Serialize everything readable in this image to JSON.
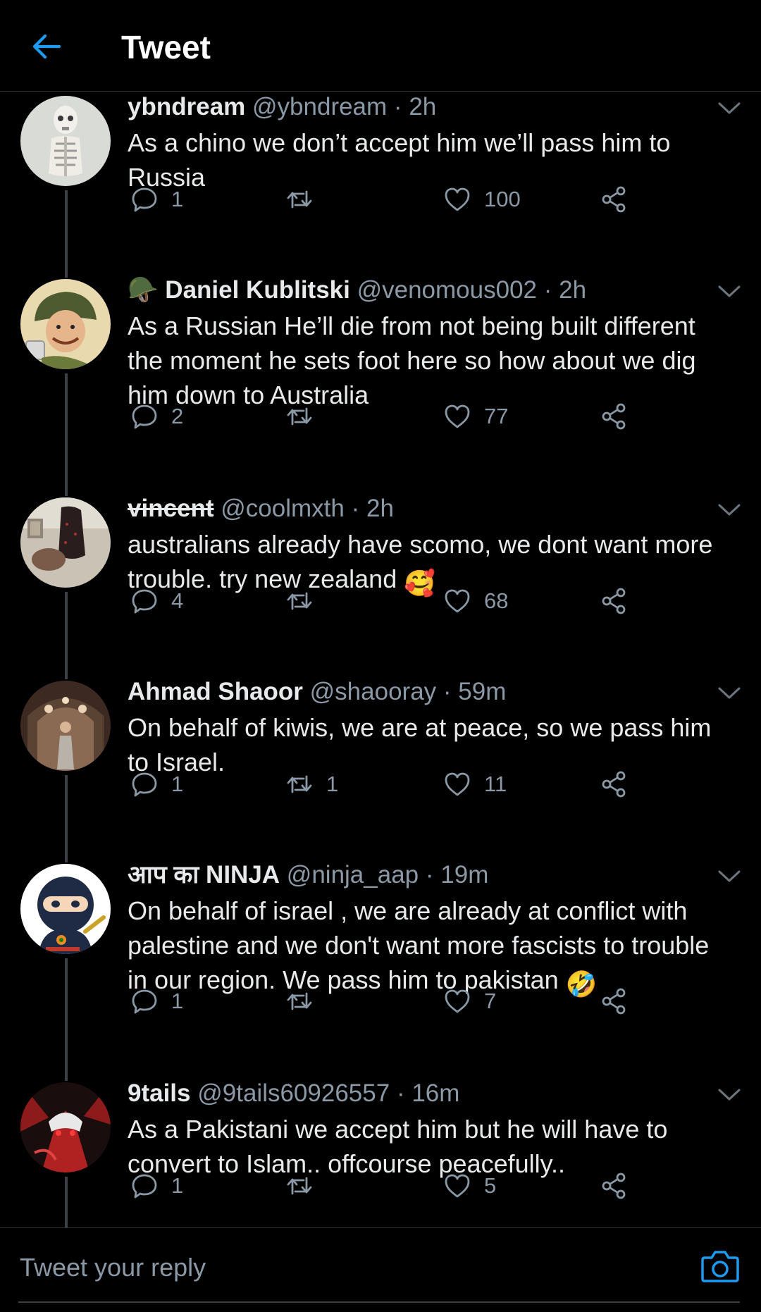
{
  "header": {
    "title": "Tweet"
  },
  "tweets": [
    {
      "name": "ybndream",
      "handle": "@ybndream",
      "time": "2h",
      "text": "As a chino we don’t accept him we’ll pass him to Russia",
      "emoji": "",
      "replies": "1",
      "retweets": "",
      "likes": "100",
      "strike": false
    },
    {
      "name": "🪖 Daniel Kublitski",
      "handle": "@venomous002",
      "time": "2h",
      "text": "As a Russian He’ll die from not being built different the moment he sets foot here so how about we dig him down to Australia",
      "emoji": "",
      "replies": "2",
      "retweets": "",
      "likes": "77",
      "strike": false
    },
    {
      "name": "vincent",
      "handle": "@coolmxth",
      "time": "2h",
      "text": "australians already have scomo, we dont want more trouble. try new zealand",
      "emoji": "🥰",
      "replies": "4",
      "retweets": "",
      "likes": "68",
      "strike": true
    },
    {
      "name": "Ahmad Shaoor",
      "handle": "@shaooray",
      "time": "59m",
      "text": "On behalf of kiwis, we are at peace, so we pass him to Israel.",
      "emoji": "",
      "replies": "1",
      "retweets": "1",
      "likes": "11",
      "strike": false
    },
    {
      "name": "आप का NINJA",
      "handle": "@ninja_aap",
      "time": "19m",
      "text": "On behalf of israel , we are already at conflict with palestine and we don't want more fascists to trouble in our region. We pass him to pakistan",
      "emoji": "🤣",
      "replies": "1",
      "retweets": "",
      "likes": "7",
      "strike": false
    },
    {
      "name": "9tails",
      "handle": "@9tails60926557",
      "time": "16m",
      "text": "As a Pakistani we accept him but he will have to convert to Islam.. offcourse peacefully..",
      "emoji": "",
      "replies": "1",
      "retweets": "",
      "likes": "5",
      "strike": false
    }
  ],
  "sep": "·",
  "reply_bar": {
    "placeholder": "Tweet your reply"
  },
  "colors": {
    "accent": "#1d9bf0",
    "text": "#e7e9ea",
    "muted": "#8b98a5",
    "background": "#000000"
  },
  "icons": [
    "back-arrow-icon",
    "chevron-down-icon",
    "reply-icon",
    "retweet-icon",
    "like-icon",
    "share-icon",
    "camera-icon"
  ]
}
